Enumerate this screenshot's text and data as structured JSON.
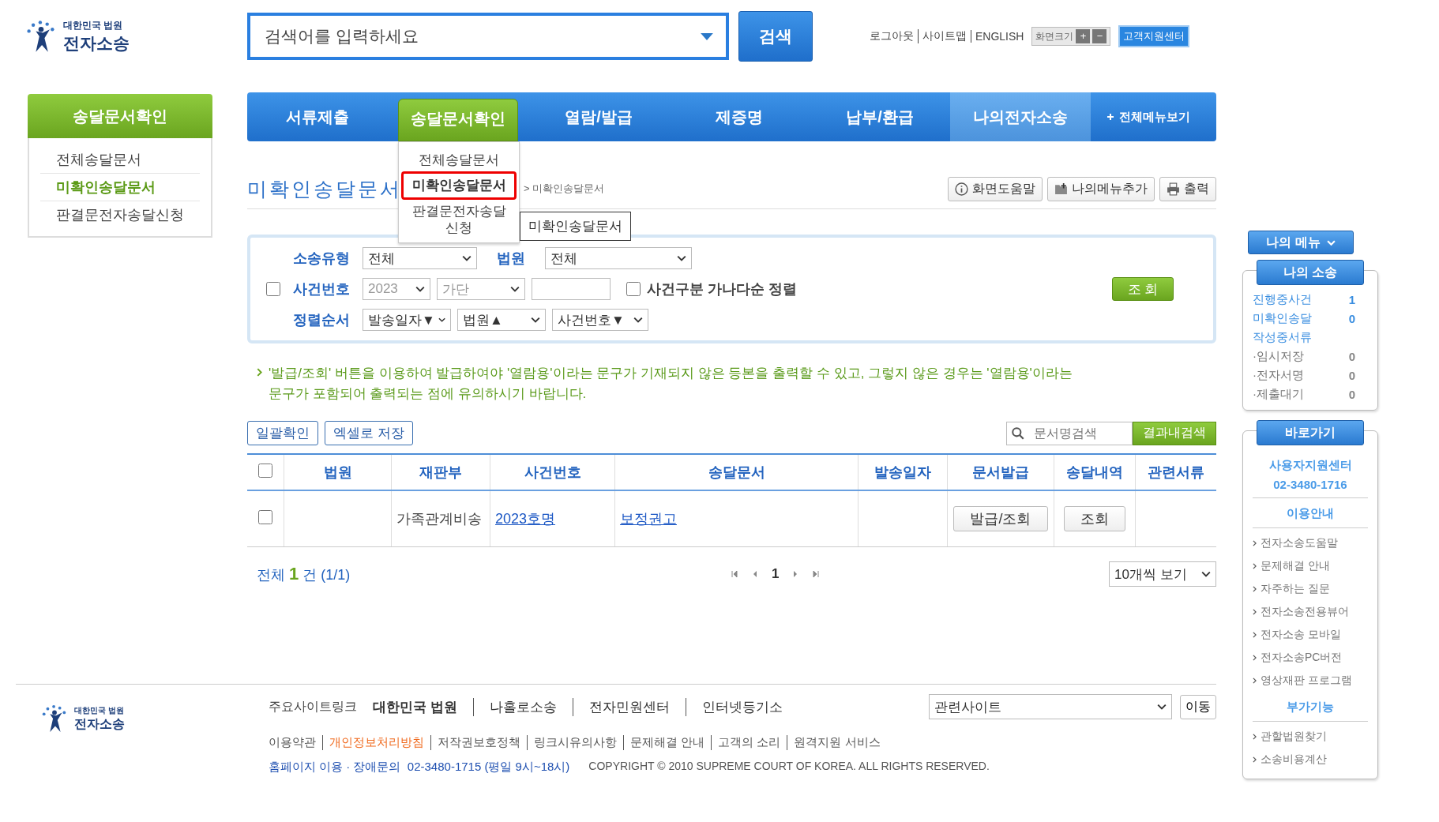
{
  "logo": {
    "org": "대한민국 법원",
    "name": "전자소송"
  },
  "search": {
    "placeholder": "검색어를 입력하세요",
    "button": "검색"
  },
  "top_links": [
    "로그아웃",
    "사이트맵",
    "ENGLISH"
  ],
  "font_size": {
    "label": "화면크기",
    "plus": "+",
    "minus": "−"
  },
  "support_button": "고객지원센터",
  "nav": {
    "items": [
      {
        "label": "서류제출",
        "selected": false,
        "highlighted": false
      },
      {
        "label": "송달문서확인",
        "selected": true,
        "highlighted": false
      },
      {
        "label": "열람/발급",
        "selected": false,
        "highlighted": false
      },
      {
        "label": "제증명",
        "selected": false,
        "highlighted": false
      },
      {
        "label": "납부/환급",
        "selected": false,
        "highlighted": false
      },
      {
        "label": "나의전자소송",
        "selected": false,
        "highlighted": true
      }
    ],
    "all_menu": "전체메뉴보기",
    "dropdown": [
      {
        "label": "전체송달문서",
        "selected": false
      },
      {
        "label": "미확인송달문서",
        "selected": true
      },
      {
        "label": "판결문전자송달신청",
        "selected": false
      }
    ],
    "tooltip": "미확인송달문서"
  },
  "sidebar": {
    "title": "송달문서확인",
    "items": [
      {
        "label": "전체송달문서",
        "selected": false
      },
      {
        "label": "미확인송달문서",
        "selected": true
      },
      {
        "label": "판결문전자송달신청",
        "selected": false
      }
    ]
  },
  "page_title": "미확인송달문서",
  "breadcrumb": "> 미확인송달문서",
  "tools": [
    {
      "kind": "help",
      "label": "화면도움말"
    },
    {
      "kind": "add",
      "label": "나의메뉴추가"
    },
    {
      "kind": "print",
      "label": "출력"
    }
  ],
  "filter": {
    "type_label": "소송유형",
    "type_value": "전체",
    "court_label": "법원",
    "court_value": "전체",
    "case_checked": false,
    "case_label": "사건번호",
    "year": "2023",
    "case_kind": "가단",
    "sort_checked": false,
    "sort_label": "사건구분 가나다순 정렬",
    "order_label": "정렬순서",
    "orders": [
      "발송일자▼",
      "법원▲",
      "사건번호▼"
    ],
    "query_button": "조 회"
  },
  "notice": "'발급/조회' 버튼을 이용하여 발급하여야 '열람용'이라는 문구가 기재되지 않은 등본을 출력할 수 있고, 그렇지 않은 경우는 '열람용'이라는 문구가 포함되어 출력되는 점에 유의하시기 바랍니다.",
  "actions": [
    "일괄확인",
    "엑셀로 저장"
  ],
  "doc_search": {
    "placeholder": "문서명검색",
    "button": "결과내검색"
  },
  "table": {
    "all_checked": false,
    "columns": [
      "법원",
      "재판부",
      "사건번호",
      "송달문서",
      "발송일자",
      "문서발급",
      "송달내역",
      "관련서류"
    ],
    "rows": [
      {
        "checked": false,
        "division": "가족관계비송",
        "case_no": "2023호명",
        "document": "보정권고",
        "issue_button": "발급/조회",
        "history_button": "조회"
      }
    ]
  },
  "summary": {
    "prefix": "전체",
    "count": "1",
    "suffix": "건 (1/1)"
  },
  "pages": [
    {
      "label": "1",
      "selected": true
    }
  ],
  "page_size": "10개씩 보기",
  "footer": {
    "logo": {
      "org": "대한민국 법원",
      "name": "전자소송"
    },
    "sites_label": "주요사이트링크",
    "sites": [
      "대한민국 법원",
      "나홀로소송",
      "전자민원센터",
      "인터넷등기소"
    ],
    "related": "관련사이트",
    "go_button": "이동",
    "policies": [
      {
        "label": "이용약관",
        "highlighted": false
      },
      {
        "label": "개인정보처리방침",
        "highlighted": true
      },
      {
        "label": "저작권보호정책",
        "highlighted": false
      },
      {
        "label": "링크시유의사항",
        "highlighted": false
      },
      {
        "label": "문제해결 안내",
        "highlighted": false
      },
      {
        "label": "고객의 소리",
        "highlighted": false
      },
      {
        "label": "원격지원 서비스",
        "highlighted": false
      }
    ],
    "contact": "홈페이지 이용 · 장애문의  02-3480-1715 (평일 9시~18시)",
    "copyright": "COPYRIGHT © 2010 SUPREME COURT OF KOREA. ALL RIGHTS RESERVED."
  },
  "right": {
    "my_menu": "나의 메뉴",
    "my_case": {
      "title": "나의 소송",
      "items": [
        {
          "kind": "main",
          "label": "진행중사건",
          "count": "1"
        },
        {
          "kind": "main",
          "label": "미확인송달",
          "count": "0"
        },
        {
          "kind": "main",
          "label": "작성중서류"
        },
        {
          "kind": "sub",
          "label": "·임시저장",
          "count": "0"
        },
        {
          "kind": "sub",
          "label": "·전자서명",
          "count": "0"
        },
        {
          "kind": "sub",
          "label": "·제출대기",
          "count": "0"
        }
      ]
    },
    "shortcuts": {
      "title": "바로가기",
      "center": "사용자지원센터",
      "phone": "02-3480-1716",
      "sections": [
        {
          "heading": "이용안내",
          "links": [
            "전자소송도움말",
            "문제해결 안내",
            "자주하는 질문",
            "전자소송전용뷰어",
            "전자소송 모바일",
            "전자소송PC버전",
            "영상재판 프로그램"
          ]
        },
        {
          "heading": "부가기능",
          "links": [
            "관할법원찾기",
            "소송비용계산"
          ]
        }
      ]
    }
  }
}
